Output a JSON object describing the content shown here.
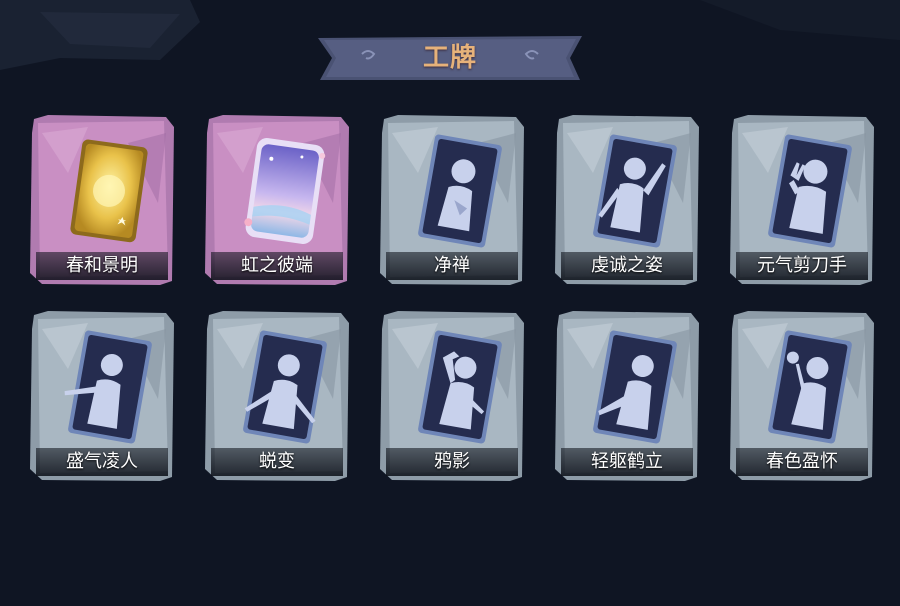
{
  "header": {
    "title": "工牌"
  },
  "colors": {
    "background": "#0f1523",
    "title_text": "#e6b27a",
    "banner": "#4a5273",
    "frame_purple": "#b07bb0",
    "frame_silver": "#9aa9b4",
    "card_navy": "#252c4f",
    "silhouette": "#c8d1ec"
  },
  "badges": [
    {
      "label": "春和景明",
      "frame": "purple",
      "icon": "golden-card-icon"
    },
    {
      "label": "虹之彼端",
      "frame": "purple",
      "icon": "rainbow-card-icon"
    },
    {
      "label": "净禅",
      "frame": "silver",
      "icon": "silhouette-hand-chest-icon"
    },
    {
      "label": "虔诚之姿",
      "frame": "silver",
      "icon": "silhouette-arm-raised-icon"
    },
    {
      "label": "元气剪刀手",
      "frame": "silver",
      "icon": "silhouette-peace-sign-icon"
    },
    {
      "label": "盛气凌人",
      "frame": "silver",
      "icon": "silhouette-pointing-icon"
    },
    {
      "label": "蜕变",
      "frame": "silver",
      "icon": "silhouette-arms-open-icon"
    },
    {
      "label": "鸦影",
      "frame": "silver",
      "icon": "silhouette-hand-head-icon"
    },
    {
      "label": "轻躯鹤立",
      "frame": "silver",
      "icon": "silhouette-crane-pose-icon"
    },
    {
      "label": "春色盈怀",
      "frame": "silver",
      "icon": "silhouette-flower-icon"
    }
  ]
}
